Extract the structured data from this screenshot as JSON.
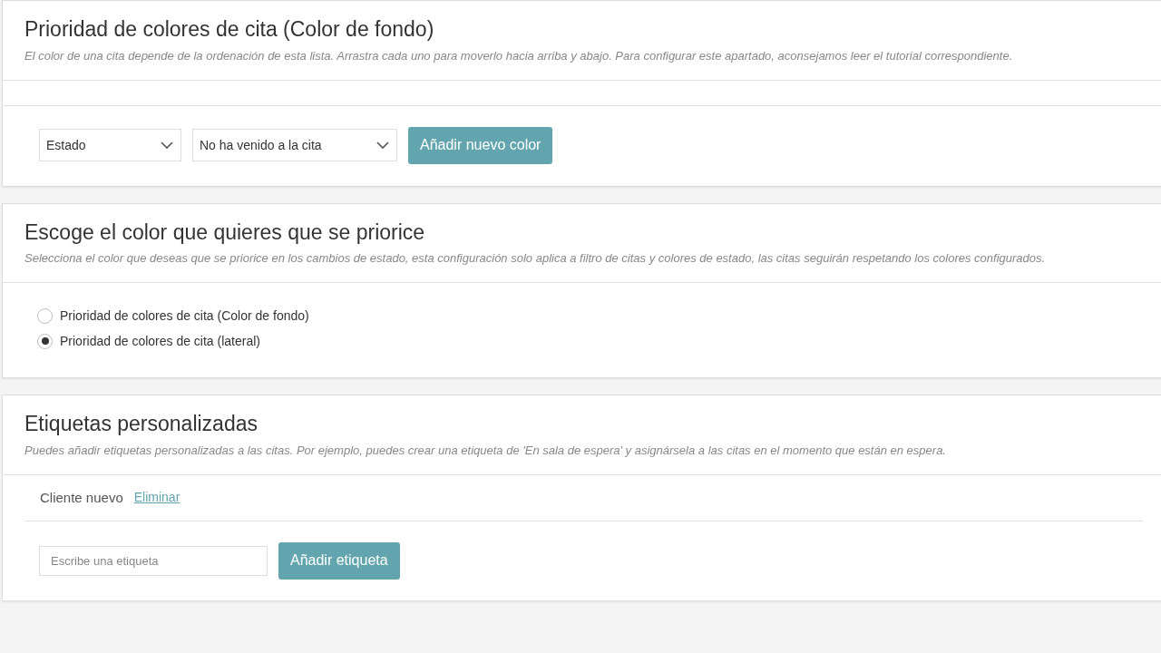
{
  "color_priority": {
    "title": "Prioridad de colores de cita (Color de fondo)",
    "description": "El color de una cita depende de la ordenación de esta lista. Arrastra cada uno para moverlo hacia arriba y abajo. Para configurar este apartado, aconsejamos leer el tutorial correspondiente.",
    "type_select": {
      "value": "Estado"
    },
    "value_select": {
      "value": "No ha venido a la cita"
    },
    "add_button": "Añadir nuevo color"
  },
  "priority_choice": {
    "title": "Escoge el color que quieres que se priorice",
    "description": "Selecciona el color que deseas que se priorice en los cambios de estado, esta configuración solo aplica a filtro de citas y colores de estado, las citas seguirán respetando los colores configurados.",
    "options": [
      {
        "label": "Prioridad de colores de cita (Color de fondo)",
        "selected": false
      },
      {
        "label": "Prioridad de colores de cita (lateral)",
        "selected": true
      }
    ]
  },
  "custom_tags": {
    "title": "Etiquetas personalizadas",
    "description": "Puedes añadir etiquetas personalizadas a las citas. Por ejemplo, puedes crear una etiqueta de 'En sala de espera' y asignársela a las citas en el momento que están en espera.",
    "tags": [
      {
        "name": "Cliente nuevo",
        "delete_link": "Eliminar"
      }
    ],
    "input": {
      "placeholder": "Escribe una etiqueta"
    },
    "add_button": "Añadir etiqueta"
  }
}
